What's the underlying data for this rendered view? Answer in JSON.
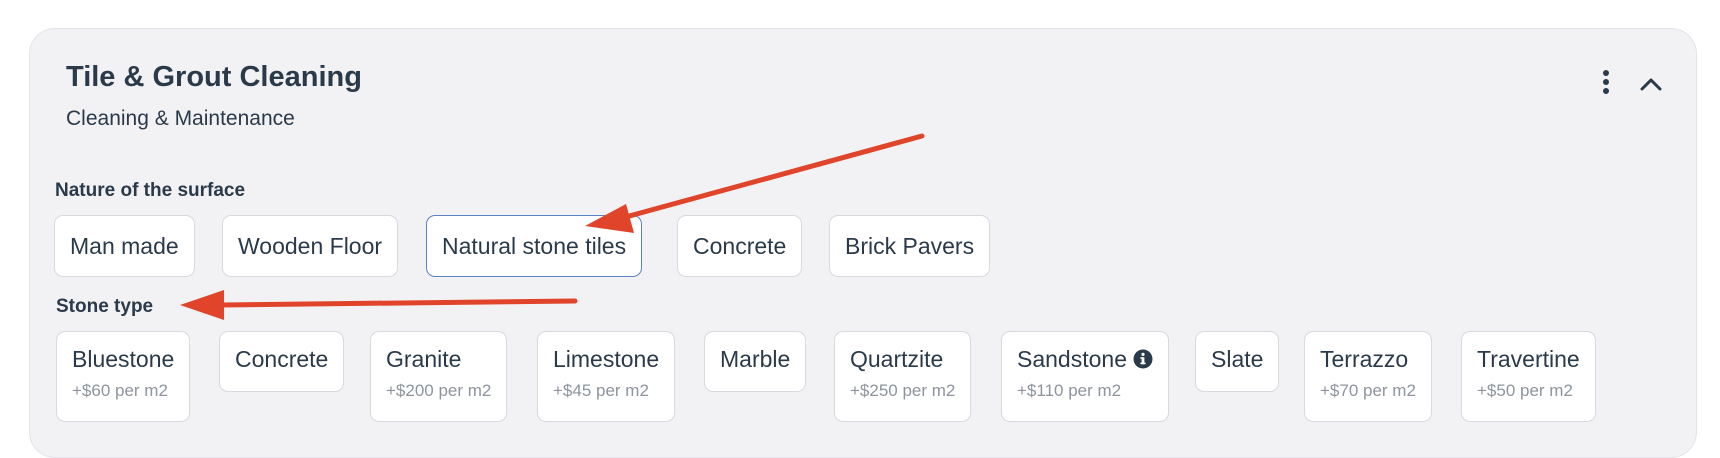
{
  "service": {
    "title": "Tile & Grout Cleaning",
    "category": "Cleaning & Maintenance"
  },
  "icons": {
    "menu": "more-vertical-icon",
    "collapse": "chevron-up-icon",
    "info": "info-circle-icon"
  },
  "surface": {
    "label": "Nature of the surface",
    "selected": "Natural stone tiles",
    "options": [
      "Man made",
      "Wooden Floor",
      "Natural stone tiles",
      "Concrete",
      "Brick Pavers"
    ]
  },
  "stone": {
    "label": "Stone type",
    "options": [
      {
        "name": "Bluestone",
        "price": "+$60 per m2"
      },
      {
        "name": "Concrete",
        "price": ""
      },
      {
        "name": "Granite",
        "price": "+$200 per m2"
      },
      {
        "name": "Limestone",
        "price": "+$45 per m2"
      },
      {
        "name": "Marble",
        "price": ""
      },
      {
        "name": "Quartzite",
        "price": "+$250 per m2"
      },
      {
        "name": "Sandstone",
        "price": "+$110 per m2"
      },
      {
        "name": "Slate",
        "price": ""
      },
      {
        "name": "Terrazzo",
        "price": "+$70 per m2"
      },
      {
        "name": "Travertine",
        "price": "+$50 per m2"
      }
    ]
  },
  "colors": {
    "annotation_arrow": "#e0442a",
    "selected_border": "#5b82c4",
    "card_background": "#f2f2f4"
  }
}
